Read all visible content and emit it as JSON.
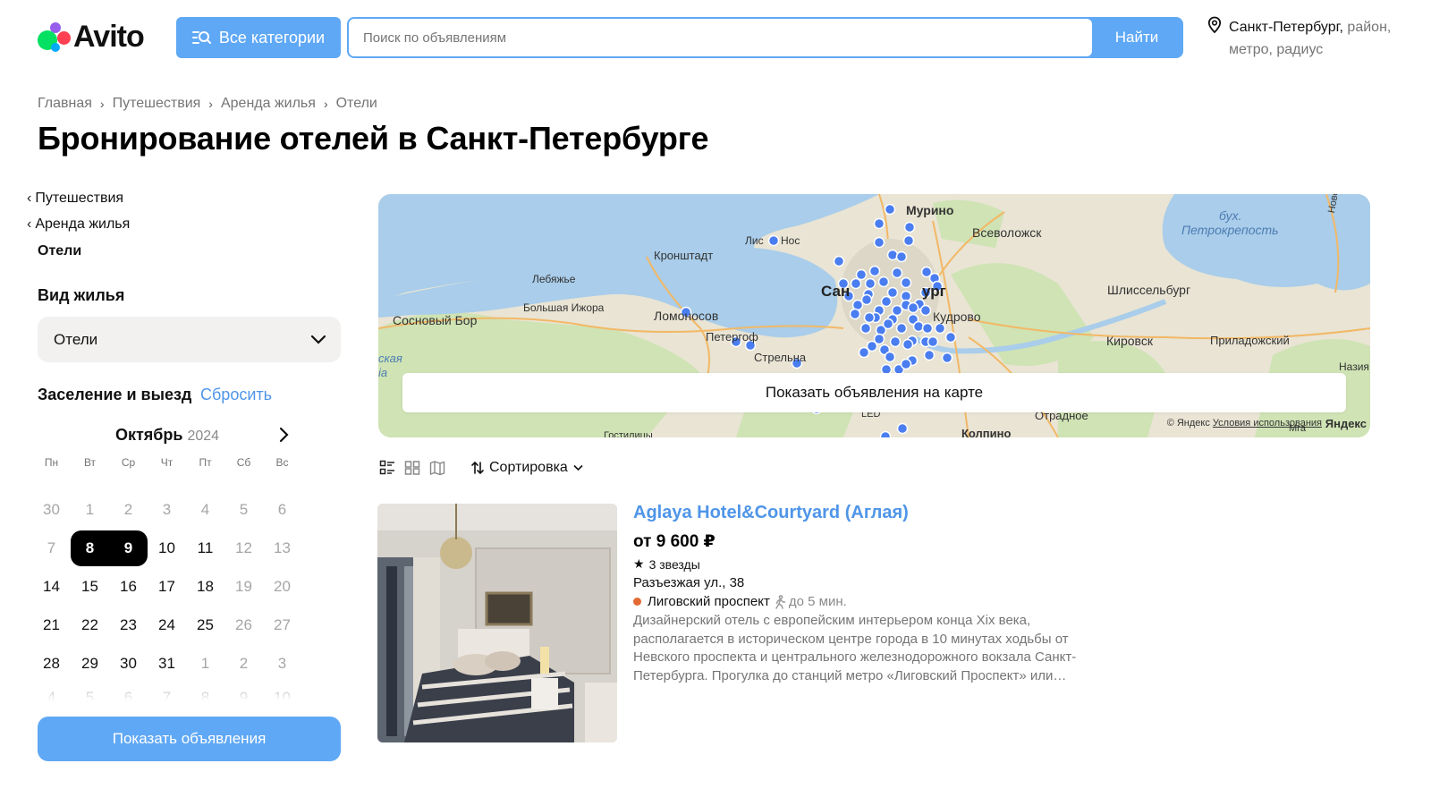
{
  "header": {
    "logo_text": "Avito",
    "categories_button": "Все категории",
    "search_placeholder": "Поиск по объявлениям",
    "search_button": "Найти",
    "location_city": "Санкт-Петербург,",
    "location_rest_1": " район,",
    "location_rest_2": "метро, радиус"
  },
  "breadcrumb": [
    "Главная",
    "Путешествия",
    "Аренда жилья",
    "Отели"
  ],
  "page_title": "Бронирование отелей в Санкт-Петербурге",
  "sidebar": {
    "nav": [
      "Путешествия",
      "Аренда жилья"
    ],
    "current": "Отели",
    "housing_type_label": "Вид жилья",
    "housing_type_value": "Отели",
    "checkin_label": "Заселение и выезд",
    "reset": "Сбросить",
    "calendar": {
      "month": "Октябрь",
      "year": "2024",
      "weekdays": [
        "Пн",
        "Вт",
        "Ср",
        "Чт",
        "Пт",
        "Сб",
        "Вс"
      ],
      "weeks": [
        [
          [
            "30",
            "m"
          ],
          [
            "1",
            "m"
          ],
          [
            "2",
            "m"
          ],
          [
            "3",
            "m"
          ],
          [
            "4",
            "m"
          ],
          [
            "5",
            "m"
          ],
          [
            "6",
            "m"
          ]
        ],
        [
          [
            "7",
            "m"
          ],
          [
            "8",
            "sl"
          ],
          [
            "9",
            "sr"
          ],
          [
            "10",
            ""
          ],
          [
            "11",
            ""
          ],
          [
            "12",
            "m"
          ],
          [
            "13",
            "m"
          ]
        ],
        [
          [
            "14",
            ""
          ],
          [
            "15",
            ""
          ],
          [
            "16",
            ""
          ],
          [
            "17",
            ""
          ],
          [
            "18",
            ""
          ],
          [
            "19",
            "m"
          ],
          [
            "20",
            "m"
          ]
        ],
        [
          [
            "21",
            ""
          ],
          [
            "22",
            ""
          ],
          [
            "23",
            ""
          ],
          [
            "24",
            ""
          ],
          [
            "25",
            ""
          ],
          [
            "26",
            "m"
          ],
          [
            "27",
            "m"
          ]
        ],
        [
          [
            "28",
            ""
          ],
          [
            "29",
            ""
          ],
          [
            "30",
            ""
          ],
          [
            "31",
            ""
          ],
          [
            "1",
            "m"
          ],
          [
            "2",
            "m"
          ],
          [
            "3",
            "m"
          ]
        ]
      ]
    },
    "show_button": "Показать объявления"
  },
  "map": {
    "button": "Показать объявления на карте",
    "labels": {
      "murino": "Мурино",
      "vsevolozhsk": "Всеволожск",
      "bay_1": "бух.",
      "bay_2": "Петрокрепость",
      "lis": "Лис",
      "nos": "Нос",
      "kronshtadt": "Кронштадт",
      "lebyazhye": "Лебяжье",
      "b_izhora": "Большая Ижора",
      "sosnovy": "Сосновый Бор",
      "lomonosov": "Ломоносов",
      "peterhof": "Петергоф",
      "strelna": "Стрельна",
      "spb_a": "Сан",
      "spb_b": "ург",
      "kudrovo": "Кудрово",
      "shlisselburg": "Шлиссельбург",
      "kirovsk": "Кировск",
      "priladozhsky": "Приладожский",
      "nazia": "Назия",
      "otradnoe": "Отрадное",
      "kolpino": "Колпино",
      "led": "LED",
      "gostilitsy": "Гостилицы",
      "mga": "Мга",
      "novoladozhsky": "Новоладожский",
      "kaya": "ская",
      "ia": "ia"
    },
    "copyright": "© Яндекс",
    "terms": "Условия использования",
    "yandex": "Яндекс"
  },
  "toolbar": {
    "sort_label": "Сортировка"
  },
  "listing": {
    "title": "Aglaya Hotel&Courtyard (Аглая)",
    "price": "от 9 600 ₽",
    "stars": "3 звезды",
    "address": "Разъезжая ул., 38",
    "metro": "Лиговский проспект",
    "walk": "до 5 мин.",
    "description": "Дизайнерский отель с европейским интерьером конца Xix века, располагается в историческом центре города в 10 минутах ходьбы от Невского проспекта и центрального железнодорожного вокзала Санкт-Петербурга. Прогулка до станций метро «Лиговский Проспект» или…"
  },
  "colors": {
    "accent": "#5fa8f5",
    "link": "#4f95e8",
    "marker": "#4a7df0",
    "metro_line": "#e26a32"
  }
}
